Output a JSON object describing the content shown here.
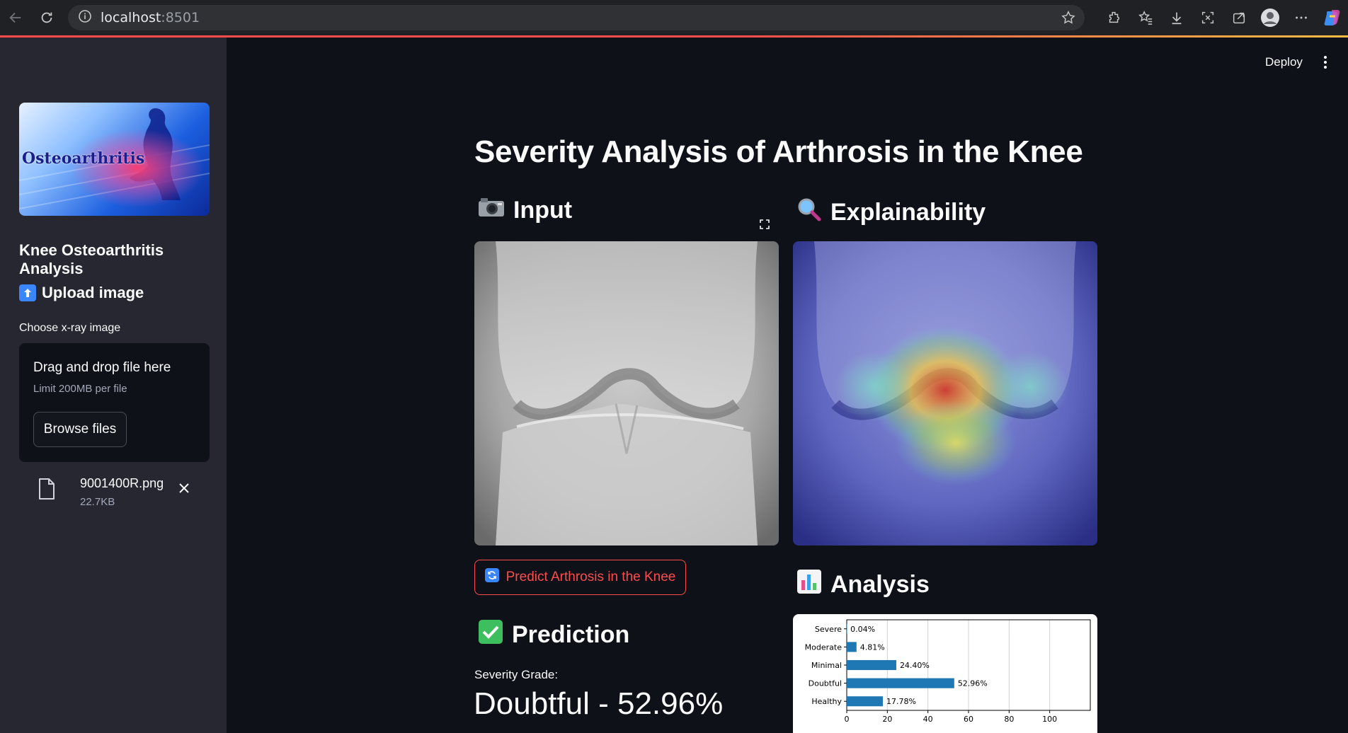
{
  "browser": {
    "url_host": "localhost",
    "url_port": ":8501"
  },
  "header": {
    "deploy_label": "Deploy"
  },
  "sidebar": {
    "logo_text": "Osteoarthritis",
    "title": "Knee Osteoarthritis Analysis",
    "upload_heading": "Upload image",
    "file_label": "Choose x-ray image",
    "dropzone_title": "Drag and drop file here",
    "dropzone_limit": "Limit 200MB per file",
    "browse_label": "Browse files",
    "file_name": "9001400R.png",
    "file_size": "22.7KB"
  },
  "main": {
    "title": "Severity Analysis of Arthrosis in the Knee",
    "input_heading": "Input",
    "explain_heading": "Explainability",
    "predict_label": "Predict Arthrosis in the Knee",
    "prediction_heading": "Prediction",
    "severity_label": "Severity Grade:",
    "severity_value": "Doubtful - 52.96%",
    "analysis_heading": "Analysis"
  },
  "colors": {
    "accent": "#ff4b4b",
    "bar": "#1f77b4"
  },
  "chart_data": {
    "type": "bar",
    "orientation": "horizontal",
    "categories": [
      "Severe",
      "Moderate",
      "Minimal",
      "Doubtful",
      "Healthy"
    ],
    "values": [
      0.04,
      4.81,
      24.4,
      52.96,
      17.78
    ],
    "data_labels": [
      "0.04%",
      "4.81%",
      "24.40%",
      "52.96%",
      "17.78%"
    ],
    "xticks": [
      "0",
      "20",
      "40",
      "60",
      "80",
      "100"
    ],
    "xlim": [
      0,
      120
    ],
    "grid": true
  }
}
